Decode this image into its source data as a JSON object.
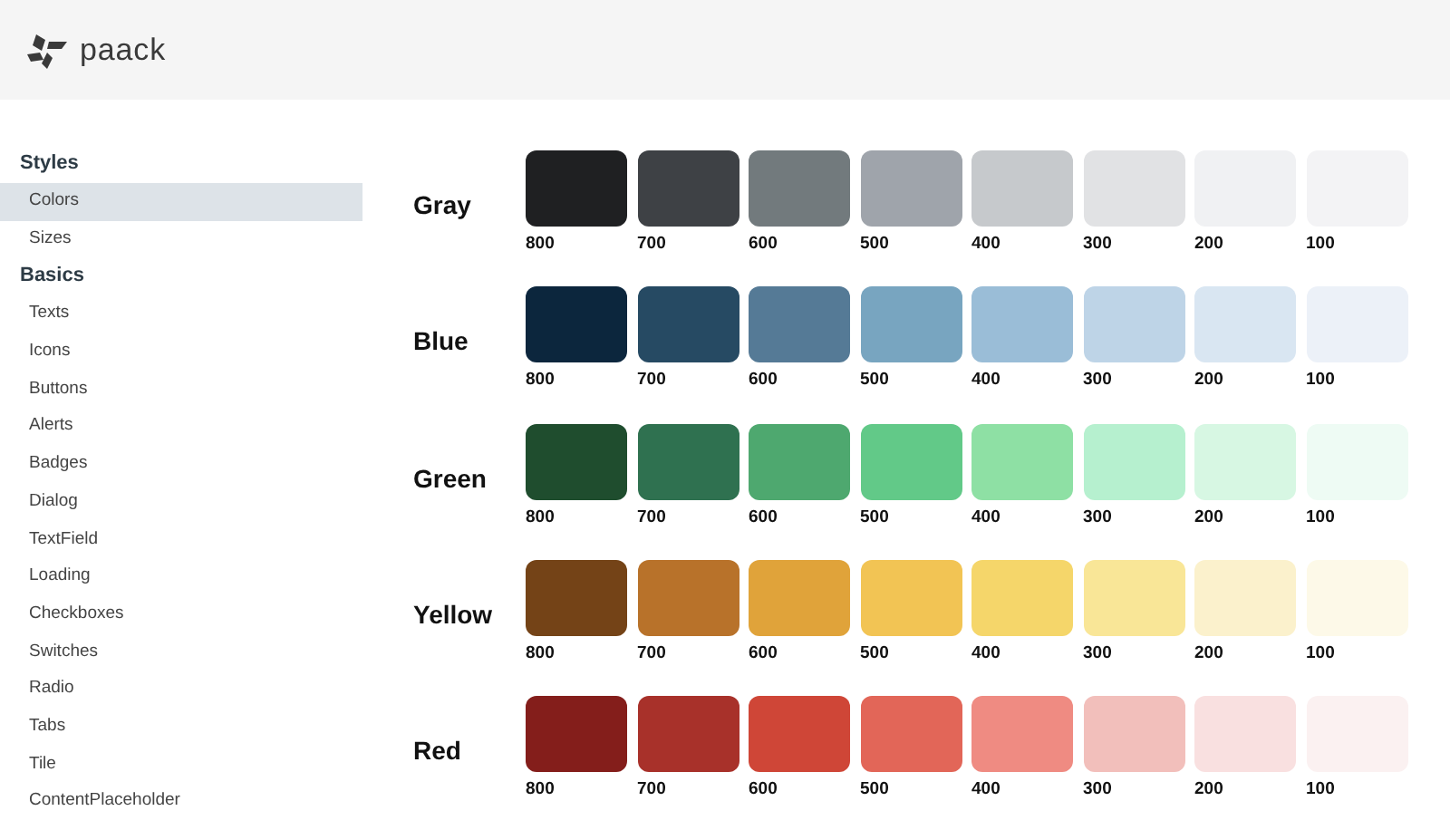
{
  "header": {
    "logo_text": "paack"
  },
  "sidebar": {
    "sections": [
      {
        "heading": "Styles",
        "items": [
          {
            "label": "Colors",
            "selected": true
          },
          {
            "label": "Sizes",
            "selected": false
          }
        ]
      },
      {
        "heading": "Basics",
        "items": [
          {
            "label": "Texts",
            "selected": false
          },
          {
            "label": "Icons",
            "selected": false
          },
          {
            "label": "Buttons",
            "selected": false
          },
          {
            "label": "Alerts",
            "selected": false
          },
          {
            "label": "Badges",
            "selected": false
          },
          {
            "label": "Dialog",
            "selected": false
          },
          {
            "label": "TextField",
            "selected": false
          },
          {
            "label": "Loading",
            "selected": false
          },
          {
            "label": "Checkboxes",
            "selected": false
          },
          {
            "label": "Switches",
            "selected": false
          },
          {
            "label": "Radio",
            "selected": false
          },
          {
            "label": "Tabs",
            "selected": false
          },
          {
            "label": "Tile",
            "selected": false
          },
          {
            "label": "ContentPlaceholder",
            "selected": false
          }
        ]
      }
    ]
  },
  "palettes": [
    {
      "name": "Gray",
      "swatches": [
        {
          "label": "800",
          "color": "#1f2022"
        },
        {
          "label": "700",
          "color": "#3e4145"
        },
        {
          "label": "600",
          "color": "#727a7d"
        },
        {
          "label": "500",
          "color": "#9fa4ab"
        },
        {
          "label": "400",
          "color": "#c6c9cc"
        },
        {
          "label": "300",
          "color": "#e1e2e4"
        },
        {
          "label": "200",
          "color": "#f0f1f3"
        },
        {
          "label": "100",
          "color": "#f3f3f5"
        }
      ]
    },
    {
      "name": "Blue",
      "swatches": [
        {
          "label": "800",
          "color": "#0c263d"
        },
        {
          "label": "700",
          "color": "#264a63"
        },
        {
          "label": "600",
          "color": "#557a96"
        },
        {
          "label": "500",
          "color": "#78a5c0"
        },
        {
          "label": "400",
          "color": "#9abdd7"
        },
        {
          "label": "300",
          "color": "#bed4e7"
        },
        {
          "label": "200",
          "color": "#d9e6f2"
        },
        {
          "label": "100",
          "color": "#ecf1f8"
        }
      ]
    },
    {
      "name": "Green",
      "swatches": [
        {
          "label": "800",
          "color": "#1f4d2e"
        },
        {
          "label": "700",
          "color": "#2f7150"
        },
        {
          "label": "600",
          "color": "#4ea86f"
        },
        {
          "label": "500",
          "color": "#62c988"
        },
        {
          "label": "400",
          "color": "#8ee0a4"
        },
        {
          "label": "300",
          "color": "#b6f0cf"
        },
        {
          "label": "200",
          "color": "#d7f7e3"
        },
        {
          "label": "100",
          "color": "#eefbf4"
        }
      ]
    },
    {
      "name": "Yellow",
      "swatches": [
        {
          "label": "800",
          "color": "#744317"
        },
        {
          "label": "700",
          "color": "#b8722a"
        },
        {
          "label": "600",
          "color": "#e0a33a"
        },
        {
          "label": "500",
          "color": "#f2c454"
        },
        {
          "label": "400",
          "color": "#f5d66a"
        },
        {
          "label": "300",
          "color": "#f9e697"
        },
        {
          "label": "200",
          "color": "#fbf1cc"
        },
        {
          "label": "100",
          "color": "#fdf9e8"
        }
      ]
    },
    {
      "name": "Red",
      "swatches": [
        {
          "label": "800",
          "color": "#841e1b"
        },
        {
          "label": "700",
          "color": "#a8312a"
        },
        {
          "label": "600",
          "color": "#cf4637"
        },
        {
          "label": "500",
          "color": "#e26658"
        },
        {
          "label": "400",
          "color": "#ef8b82"
        },
        {
          "label": "300",
          "color": "#f2bfbb"
        },
        {
          "label": "200",
          "color": "#f9e0e0"
        },
        {
          "label": "100",
          "color": "#fbf1f1"
        }
      ]
    }
  ]
}
